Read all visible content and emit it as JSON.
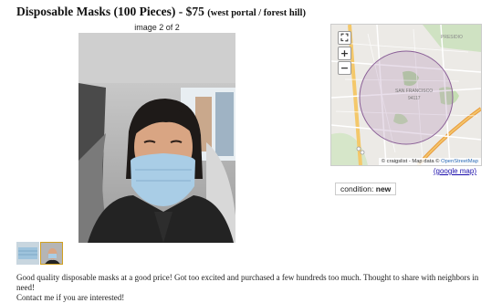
{
  "posting": {
    "title": "Disposable Masks (100 Pieces) - $75",
    "location": "(west portal / forest hill)",
    "description_line1": "Good quality disposable masks at a good price! Got too excited and purchased a few hundreds too much. Thought to share with neighbors in need!",
    "description_line2": "Contact me if you are interested!"
  },
  "gallery": {
    "counter": "image 2 of 2",
    "thumbnails": [
      {
        "name": "thumbnail-1-masks"
      },
      {
        "name": "thumbnail-2-selfie",
        "selected": true
      }
    ]
  },
  "map": {
    "attribution_prefix": "© craigslist - Map data ©",
    "attribution_link": "OpenStreetMap",
    "google_link": "(google map)",
    "controls": {
      "fullscreen": "⛶",
      "zoom_in": "+",
      "zoom_out": "−"
    }
  },
  "attributes": {
    "condition_label": "condition:",
    "condition_value": "new"
  },
  "colors": {
    "link": "#1a0dab",
    "map_circle": "#9a6fa6",
    "mask": "#a9cde6",
    "jacket": "#232323"
  }
}
